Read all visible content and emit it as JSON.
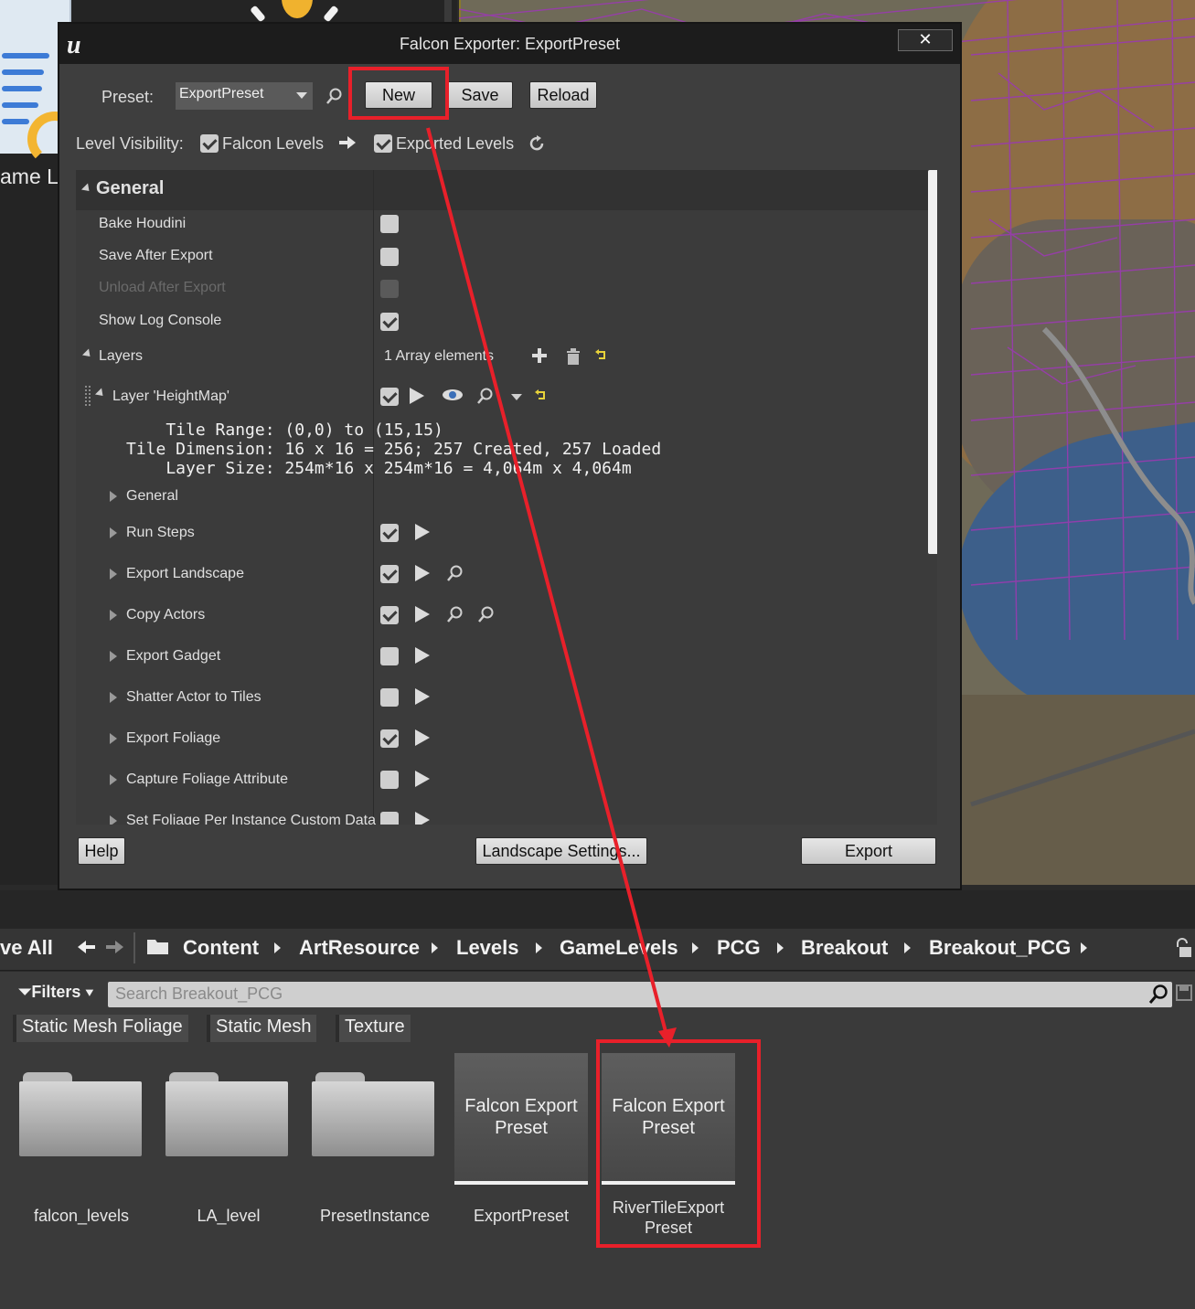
{
  "dialog": {
    "title": "Falcon Exporter: ExportPreset",
    "close": "✕",
    "preset_label": "Preset:",
    "preset_value": "ExportPreset",
    "buttons": {
      "new": "New",
      "save": "Save",
      "reload": "Reload"
    },
    "level_visibility_label": "Level Visibility:",
    "falcon_levels": "Falcon Levels",
    "exported_levels": "Exported Levels",
    "category": "General",
    "rows": {
      "bake_houdini": "Bake Houdini",
      "save_after_export": "Save After Export",
      "unload_after_export": "Unload After Export",
      "show_log_console": "Show Log Console",
      "layers": "Layers",
      "array_elements": "1 Array elements",
      "layer_heightmap": "Layer 'HeightMap'"
    },
    "info": {
      "tile_range": "    Tile Range: (0,0) to (15,15)",
      "tile_dimension": "Tile Dimension: 16 x 16 = 256; 257 Created, 257 Loaded",
      "layer_size": "    Layer Size: 254m*16 x 254m*16 = 4,064m x 4,064m"
    },
    "steps": {
      "general": "General",
      "run_steps": "Run Steps",
      "export_landscape": "Export Landscape",
      "copy_actors": "Copy Actors",
      "export_gadget": "Export Gadget",
      "shatter": "Shatter Actor to Tiles",
      "export_foliage": "Export Foliage",
      "capture_foliage": "Capture Foliage Attribute",
      "set_foliage": "Set Foliage Per Instance Custom Data"
    },
    "footer": {
      "help": "Help",
      "landscape_settings": "Landscape Settings...",
      "export": "Export"
    }
  },
  "background": {
    "left_label": "ame L"
  },
  "content_browser": {
    "save_all": "ve All",
    "breadcrumb": [
      "Content",
      "ArtResource",
      "Levels",
      "GameLevels",
      "PCG",
      "Breakout",
      "Breakout_PCG"
    ],
    "filters": "Filters",
    "search_placeholder": "Search Breakout_PCG",
    "filter_chips": [
      "Static Mesh Foliage",
      "Static Mesh",
      "Texture"
    ],
    "assets": {
      "folder1": "falcon_levels",
      "folder2": "LA_level",
      "folder3": "PresetInstance",
      "preset_type_1": "Falcon Export Preset",
      "preset_name_1": "ExportPreset",
      "preset_type_2": "Falcon Export Preset",
      "preset_name_2": "RiverTileExport Preset"
    }
  },
  "colors": {
    "highlight": "#e8202a",
    "accent_yellow": "#f3b531",
    "panel": "#3e3e3e"
  }
}
